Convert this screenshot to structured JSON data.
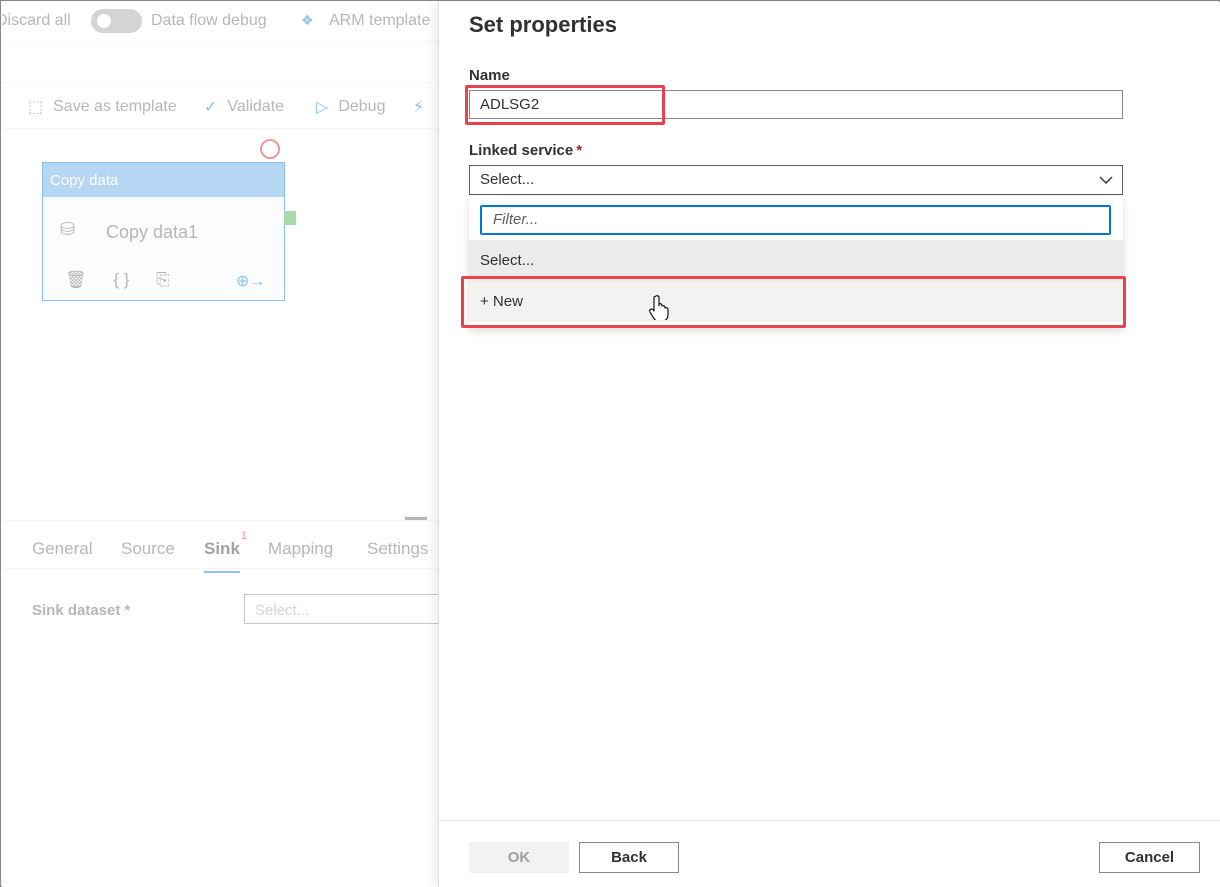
{
  "left": {
    "topbar": {
      "discard_all": "Discard all",
      "data_flow_debug": "Data flow debug",
      "arm_template": "ARM template"
    },
    "toolbar": {
      "save_as_template": "Save as template",
      "validate": "Validate",
      "debug": "Debug"
    },
    "activity": {
      "header": "Copy data",
      "name": "Copy data1"
    },
    "tabs": {
      "general": "General",
      "source": "Source",
      "sink": "Sink",
      "sink_badge": "1",
      "mapping": "Mapping",
      "settings": "Settings"
    },
    "sink_dataset": {
      "label": "Sink dataset *",
      "placeholder": "Select..."
    }
  },
  "panel": {
    "title": "Set properties",
    "name_label": "Name",
    "name_value": "ADLSG2",
    "linked_service_label": "Linked service",
    "required_mark": "*",
    "linked_service_value": "Select...",
    "filter_placeholder": "Filter...",
    "options": [
      "Select...",
      "+ New"
    ],
    "buttons": {
      "ok": "OK",
      "back": "Back",
      "cancel": "Cancel"
    }
  },
  "colors": {
    "accent": "#0078d4",
    "highlight": "#e8424f",
    "required": "#a4262c"
  }
}
